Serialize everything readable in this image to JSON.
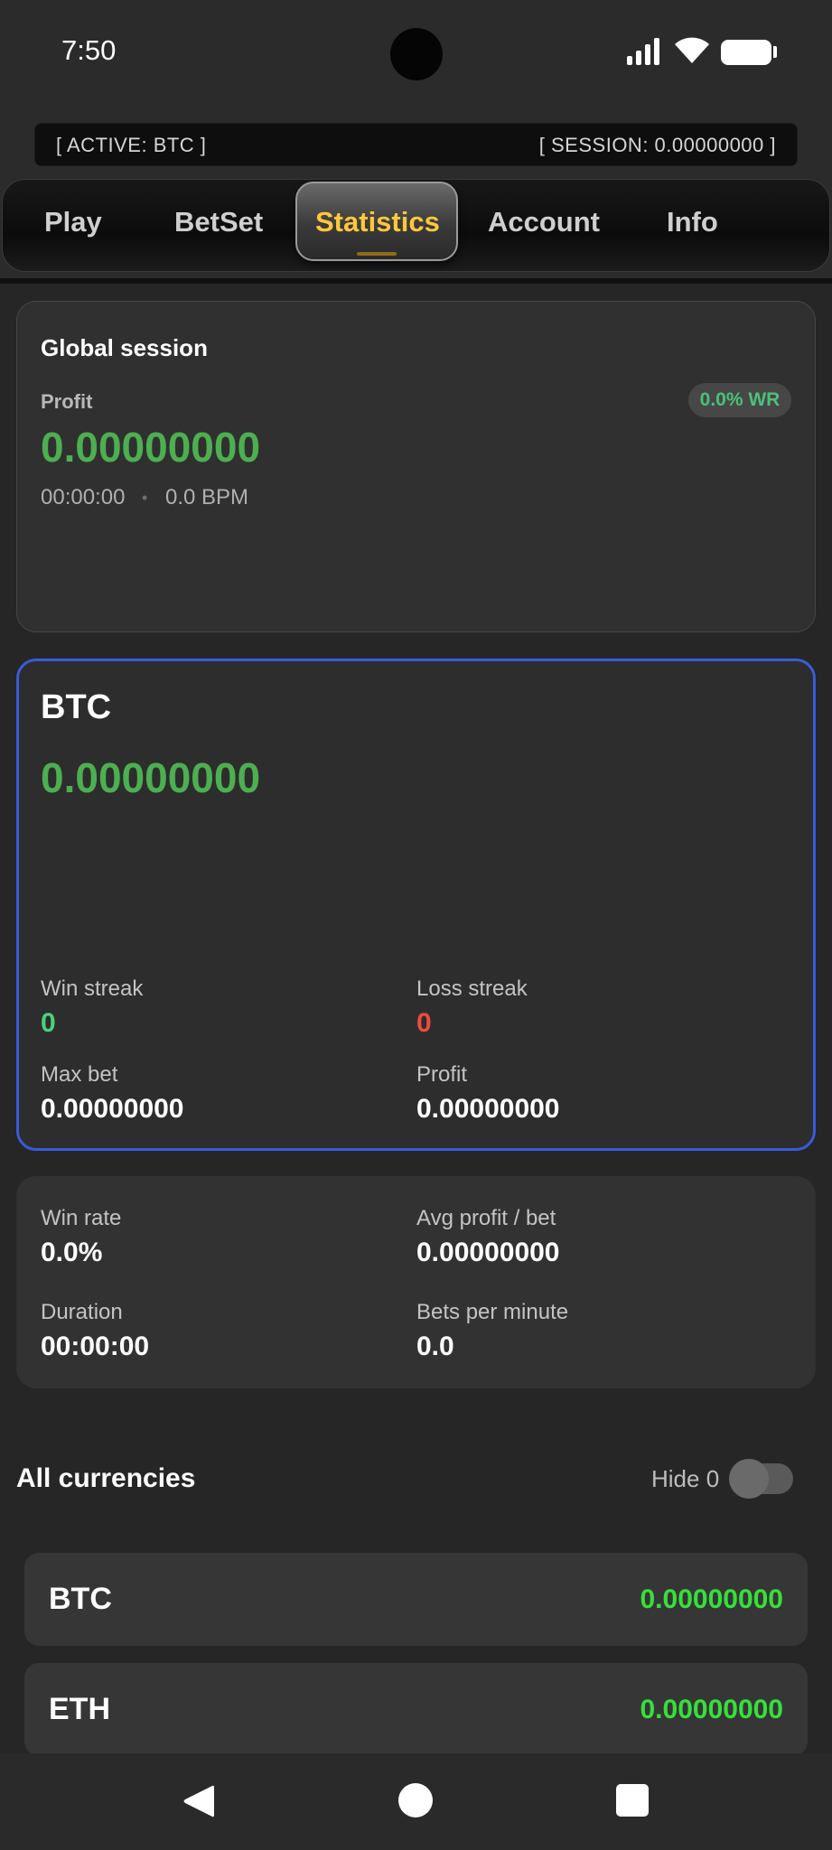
{
  "status_bar": {
    "time": "7:50"
  },
  "info_strip": {
    "active": "[ ACTIVE: BTC ]",
    "session": "[ SESSION: 0.00000000 ]"
  },
  "tabs": [
    {
      "label": "Play"
    },
    {
      "label": "BetSet"
    },
    {
      "label": "Statistics",
      "active": true
    },
    {
      "label": "Account"
    },
    {
      "label": "Info"
    }
  ],
  "global_session": {
    "title": "Global session",
    "profit_label": "Profit",
    "profit_value": "0.00000000",
    "win_rate_badge": "0.0% WR",
    "duration": "00:00:00",
    "separator": "•",
    "bpm": "0.0 BPM"
  },
  "currency_card": {
    "name": "BTC",
    "balance": "0.00000000",
    "win_streak_label": "Win streak",
    "win_streak_value": "0",
    "loss_streak_label": "Loss streak",
    "loss_streak_value": "0",
    "max_bet_label": "Max bet",
    "max_bet_value": "0.00000000",
    "profit_label": "Profit",
    "profit_value": "0.00000000"
  },
  "metrics": {
    "win_rate_label": "Win rate",
    "win_rate_value": "0.0%",
    "avg_profit_label": "Avg profit / bet",
    "avg_profit_value": "0.00000000",
    "duration_label": "Duration",
    "duration_value": "00:00:00",
    "bpm_label": "Bets per minute",
    "bpm_value": "0.0"
  },
  "all_currencies": {
    "title": "All currencies",
    "hide_zero_label": "Hide 0",
    "hide_zero_enabled": false,
    "items": [
      {
        "name": "BTC",
        "value": "0.00000000"
      },
      {
        "name": "ETH",
        "value": "0.00000000"
      }
    ]
  },
  "colors": {
    "accent_active_tab": "#ffc83a",
    "positive": "#4caf50",
    "list_value": "#36e03a",
    "loss": "#ef4a3f",
    "card_border_selected": "#3a5bd8"
  },
  "icons": {
    "signal": "signal-icon",
    "wifi": "wifi-icon",
    "battery": "battery-icon",
    "back": "back-icon",
    "home": "home-icon",
    "recent": "recent-apps-icon"
  }
}
